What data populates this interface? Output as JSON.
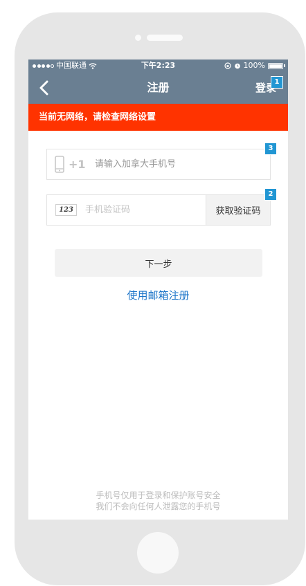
{
  "statusbar": {
    "carrier": "中国联通",
    "time": "下午2:23",
    "battery": "100%"
  },
  "navbar": {
    "title": "注册",
    "login_label": "登录",
    "back_icon": "chevron-left-icon"
  },
  "alert": {
    "message": "当前无网络，请检查网络设置"
  },
  "phone_field": {
    "prefix": "+1",
    "placeholder": "请输入加拿大手机号",
    "value": ""
  },
  "code_field": {
    "icon_text": "123",
    "placeholder": "手机验证码",
    "value": "",
    "get_code_label": "获取验证码"
  },
  "next_button": {
    "label": "下一步"
  },
  "email_link": {
    "label": "使用邮箱注册"
  },
  "footer": {
    "line1": "手机号仅用于登录和保护账号安全",
    "line2": "我们不会向任何人泄露您的手机号"
  },
  "badges": {
    "login": "1",
    "get_code": "2",
    "phone_field": "3"
  },
  "colors": {
    "header": "#6a7f92",
    "alert": "#ff3300",
    "link": "#1a73c8",
    "badge": "#2196d3"
  }
}
